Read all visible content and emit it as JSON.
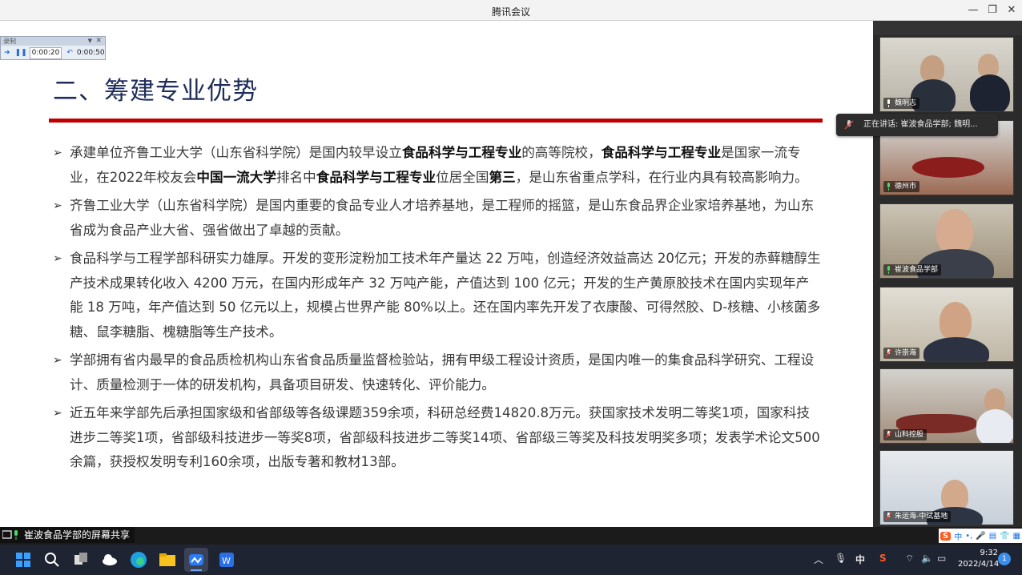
{
  "window": {
    "title": "腾讯会议"
  },
  "recorder": {
    "header": "录制",
    "time_current": "0:00:20",
    "time_total": "0:00:50"
  },
  "slide": {
    "title": "二、筹建专业优势",
    "bullets": [
      {
        "parts": [
          [
            "承建单位齐鲁工业大学（山东省科学院）是国内较早设立",
            false
          ],
          [
            "食品科学与工程专业",
            true
          ],
          [
            "的高等院校，",
            false
          ],
          [
            "食品科学与工程专业",
            true
          ],
          [
            "是国家一流专业，在2022年校友会",
            false
          ],
          [
            "中国一流大学",
            true
          ],
          [
            "排名中",
            false
          ],
          [
            "食品科学与工程专业",
            true
          ],
          [
            "位居全国",
            false
          ],
          [
            "第三",
            true
          ],
          [
            "，是山东省重点学科，在行业内具有较高影响力。",
            false
          ]
        ]
      },
      {
        "parts": [
          [
            "齐鲁工业大学（山东省科学院）是国内重要的食品专业人才培养基地，是工程师的摇篮，是山东食品界企业家培养基地，为山东省成为食品产业大省、强省做出了卓越的贡献。",
            false
          ]
        ]
      },
      {
        "parts": [
          [
            "食品科学与工程学部科研实力雄厚。开发的变形淀粉加工技术年产量达 22 万吨，创造经济效益高达 20亿元；开发的赤藓糖醇生产技术成果转化收入 4200 万元，在国内形成年产 32 万吨产能，产值达到 100 亿元；开发的生产黄原胶技术在国内实现年产能 18 万吨，年产值达到 50 亿元以上，规模占世界产能 80%以上。还在国内率先开发了衣康酸、可得然胶、D-核糖、小核菌多糖、鼠李糖脂、槐糖脂等生产技术。",
            false
          ]
        ]
      },
      {
        "parts": [
          [
            "学部拥有省内最早的食品质检机构山东省食品质量监督检验站，拥有甲级工程设计资质，是国内唯一的集食品科学研究、工程设计、质量检测于一体的研发机构，具备项目研发、快速转化、评价能力。",
            false
          ]
        ]
      },
      {
        "parts": [
          [
            "近五年来学部先后承担国家级和省部级等各级课题359余项，科研总经费14820.8万元。获国家技术发明二等奖1项，国家科技进步二等奖1项，省部级科技进步一等奖8项，省部级科技进步二等奖14项、省部级三等奖及科技发明奖多项；发表学术论文500余篇，获授权发明专利160余项，出版专著和教材13部。",
            false
          ]
        ]
      }
    ]
  },
  "speaking": {
    "text": "正在讲话: 崔波食品学部; 魏明..."
  },
  "participants": [
    {
      "name": "魏明志",
      "muted": false
    },
    {
      "name": "德州市",
      "muted": false
    },
    {
      "name": "崔波食品学部",
      "muted": false
    },
    {
      "name": "许崇海",
      "muted": true
    },
    {
      "name": "山科控股",
      "muted": true
    },
    {
      "name": "朱运海-中试基地",
      "muted": true
    }
  ],
  "share": {
    "label": "崔波食品学部的屏幕共享"
  },
  "ime": {
    "s": "S",
    "items": [
      "中",
      "•,",
      "🎤",
      "▤",
      "👕",
      "▦"
    ]
  },
  "tray": {
    "ime_lang": "中",
    "time": "9:32",
    "date": "2022/4/14",
    "notifications": "1"
  }
}
